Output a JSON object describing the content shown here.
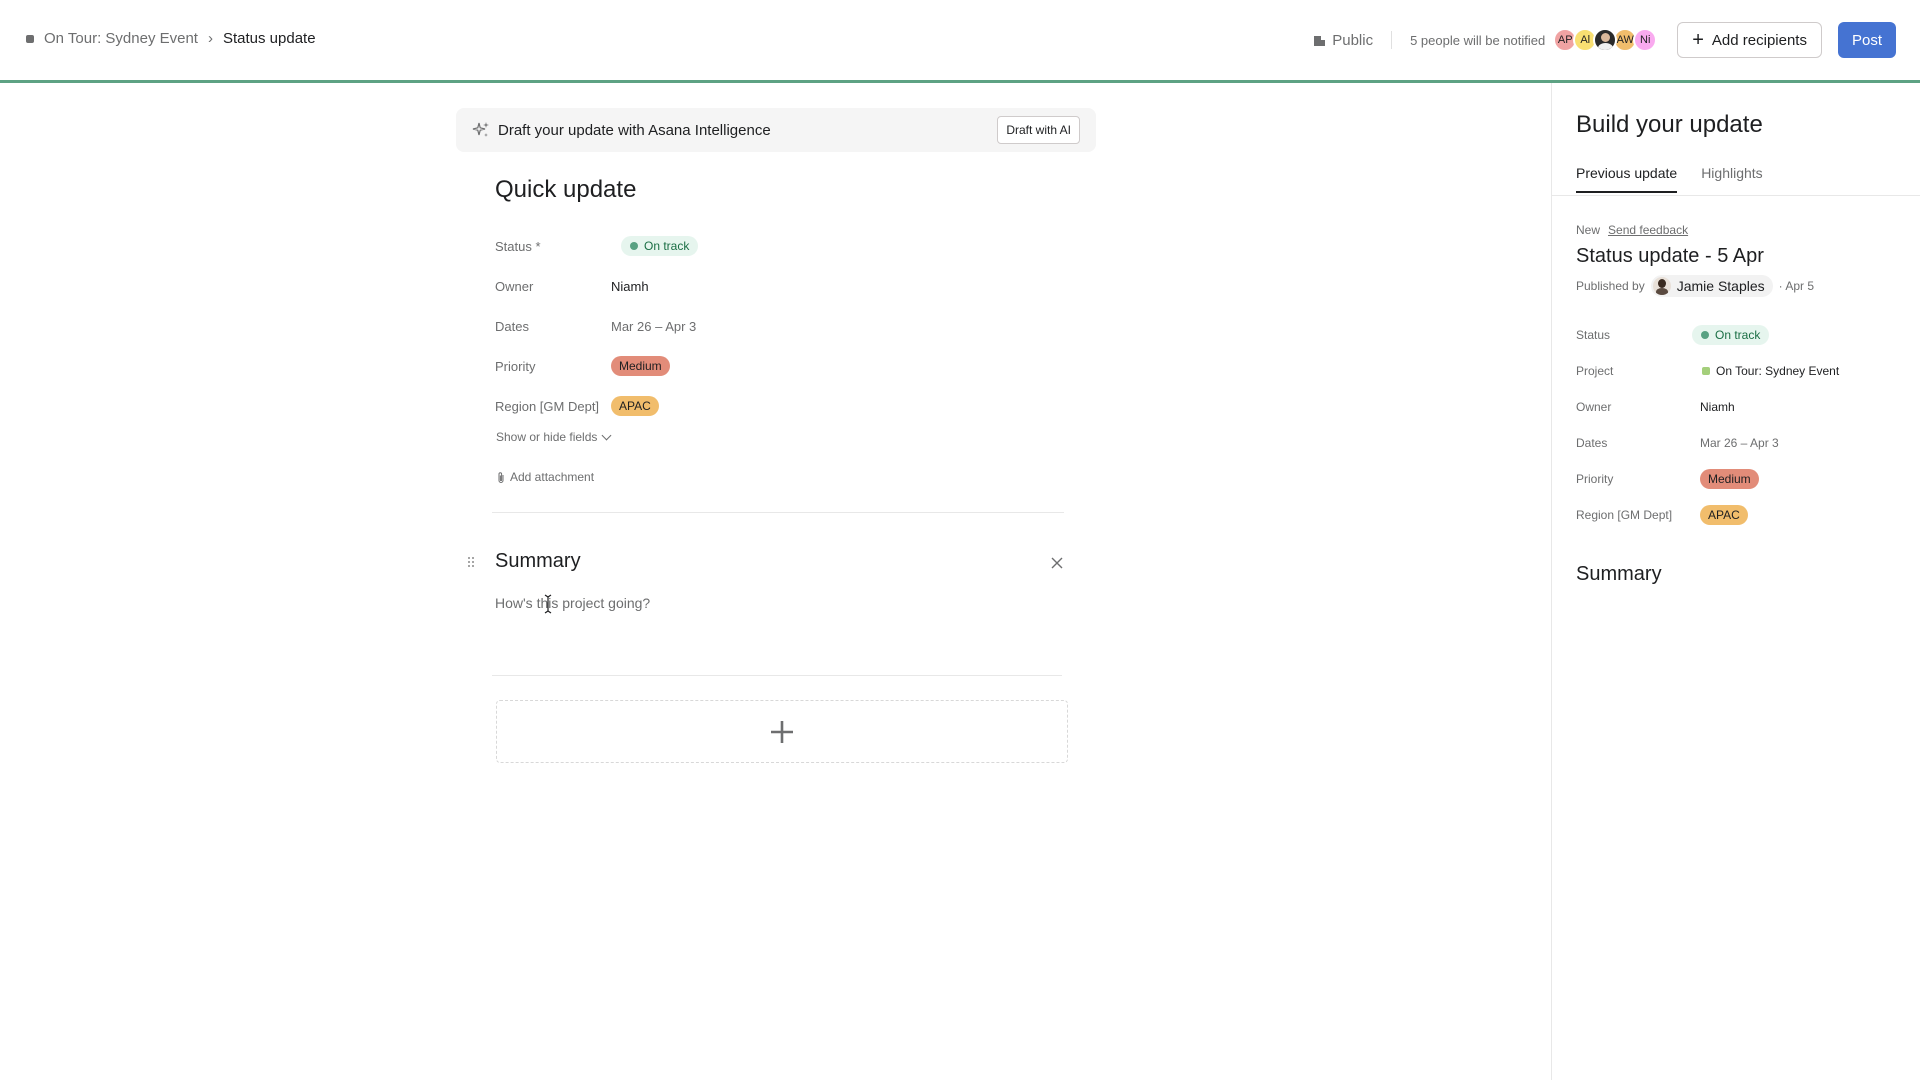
{
  "topbar": {
    "project_name": "On Tour: Sydney Event",
    "current_page": "Status update",
    "visibility": "Public",
    "notified_text": "5 people will be notified",
    "avatars": [
      "AP",
      "Al",
      "",
      "AW",
      "Ni"
    ],
    "avatar_colors": [
      "#f0a3a3",
      "#f8df72",
      "#2a2a2a",
      "#f1bd6c",
      "#f9aaef"
    ],
    "add_recipients_label": "Add recipients",
    "post_label": "Post",
    "accent_line_color": "#5da283"
  },
  "ai_banner": {
    "text": "Draft your update with Asana Intelligence",
    "button_label": "Draft with AI"
  },
  "update": {
    "title": "Quick update",
    "fields": {
      "status_label": "Status *",
      "status_value": "On track",
      "owner_label": "Owner",
      "owner_value": "Niamh",
      "dates_label": "Dates",
      "dates_value": "Mar 26 – Apr 3",
      "priority_label": "Priority",
      "priority_value": "Medium",
      "region_label": "Region [GM Dept]",
      "region_value": "APAC"
    },
    "show_hide_label": "Show or hide fields",
    "attachment_label": "Add attachment",
    "summary_heading": "Summary",
    "summary_placeholder": "How's this project going?"
  },
  "right_panel": {
    "title": "Build your update",
    "tabs": [
      "Previous update",
      "Highlights"
    ],
    "new_label": "New",
    "feedback_label": "Send feedback",
    "previous_title": "Status update - 5 Apr",
    "published_by_label": "Published by",
    "publisher": "Jamie Staples",
    "published_date": "· Apr 5",
    "fields": {
      "status_label": "Status",
      "status_value": "On track",
      "project_label": "Project",
      "project_value": "On Tour: Sydney Event",
      "owner_label": "Owner",
      "owner_value": "Niamh",
      "dates_label": "Dates",
      "dates_value": "Mar 26 – Apr 3",
      "priority_label": "Priority",
      "priority_value": "Medium",
      "region_label": "Region [GM Dept]",
      "region_value": "APAC"
    },
    "summary_heading": "Summary"
  },
  "icons": {
    "breadcrumb_separator": "›",
    "plus": "+"
  }
}
